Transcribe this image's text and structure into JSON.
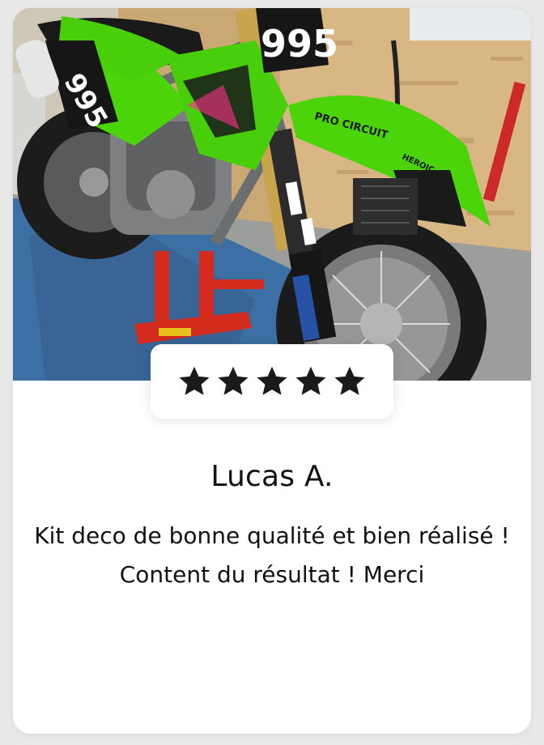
{
  "review": {
    "photo_alt": "Moto cross verte 995 avec kit déco",
    "rating": 5,
    "stars": [
      "star-filled",
      "star-filled",
      "star-filled",
      "star-filled",
      "star-filled"
    ],
    "reviewer_name": "Lucas A.",
    "text": "Kit deco de bonne qualité et bien réalisé ! Content du résultat ! Merci"
  },
  "bike": {
    "number": "995",
    "fender_text": "PRO CIRCUIT",
    "shroud_text": "HEROIC"
  },
  "colors": {
    "card_bg": "#ffffff",
    "page_bg": "#e9e9ea",
    "star": "#1a1a1a",
    "text": "#111111",
    "bike_green": "#4cd40b"
  }
}
